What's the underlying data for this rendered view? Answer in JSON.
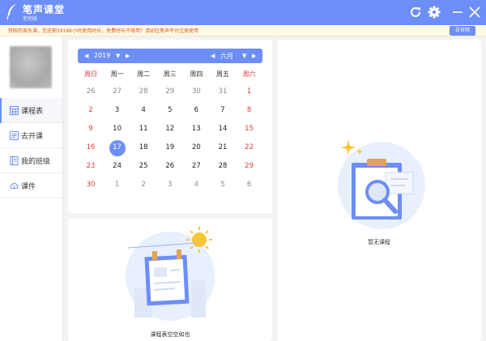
{
  "app": {
    "title": "笔声课堂",
    "subtitle": "老师版"
  },
  "notice": {
    "text": "铁粉的周东课，您还剩39186小时使用时长，免费时长不够用？请初往笔声平台注册使用",
    "button_label": "去官网"
  },
  "sidebar": {
    "items": [
      {
        "label": "课程表",
        "icon": "calendar-grid-icon",
        "active": true
      },
      {
        "label": "去开课",
        "icon": "start-class-icon",
        "active": false
      },
      {
        "label": "我的班级",
        "icon": "class-book-icon",
        "active": false
      },
      {
        "label": "课件",
        "icon": "cloud-courseware-icon",
        "active": false
      }
    ]
  },
  "calendar": {
    "year": "2019",
    "month": "六月",
    "weekdays": [
      "周日",
      "周一",
      "周二",
      "周三",
      "周四",
      "周五",
      "周六"
    ],
    "weeks": [
      [
        "26",
        "27",
        "28",
        "29",
        "30",
        "31",
        "1"
      ],
      [
        "2",
        "3",
        "4",
        "5",
        "6",
        "7",
        "8"
      ],
      [
        "9",
        "10",
        "11",
        "12",
        "13",
        "14",
        "15"
      ],
      [
        "16",
        "17",
        "18",
        "19",
        "20",
        "21",
        "22"
      ],
      [
        "23",
        "24",
        "25",
        "26",
        "27",
        "28",
        "29"
      ],
      [
        "30",
        "1",
        "2",
        "3",
        "4",
        "5",
        "6"
      ]
    ],
    "selected_day": "17",
    "colors": {
      "accent": "#6d8ef7",
      "weekend": "#e23b3b",
      "other_month": "#8a8a8a",
      "normal": "#222222"
    }
  },
  "schedule_empty": {
    "label": "课程表空空如也"
  },
  "courses_empty": {
    "label": "暂无课程"
  }
}
